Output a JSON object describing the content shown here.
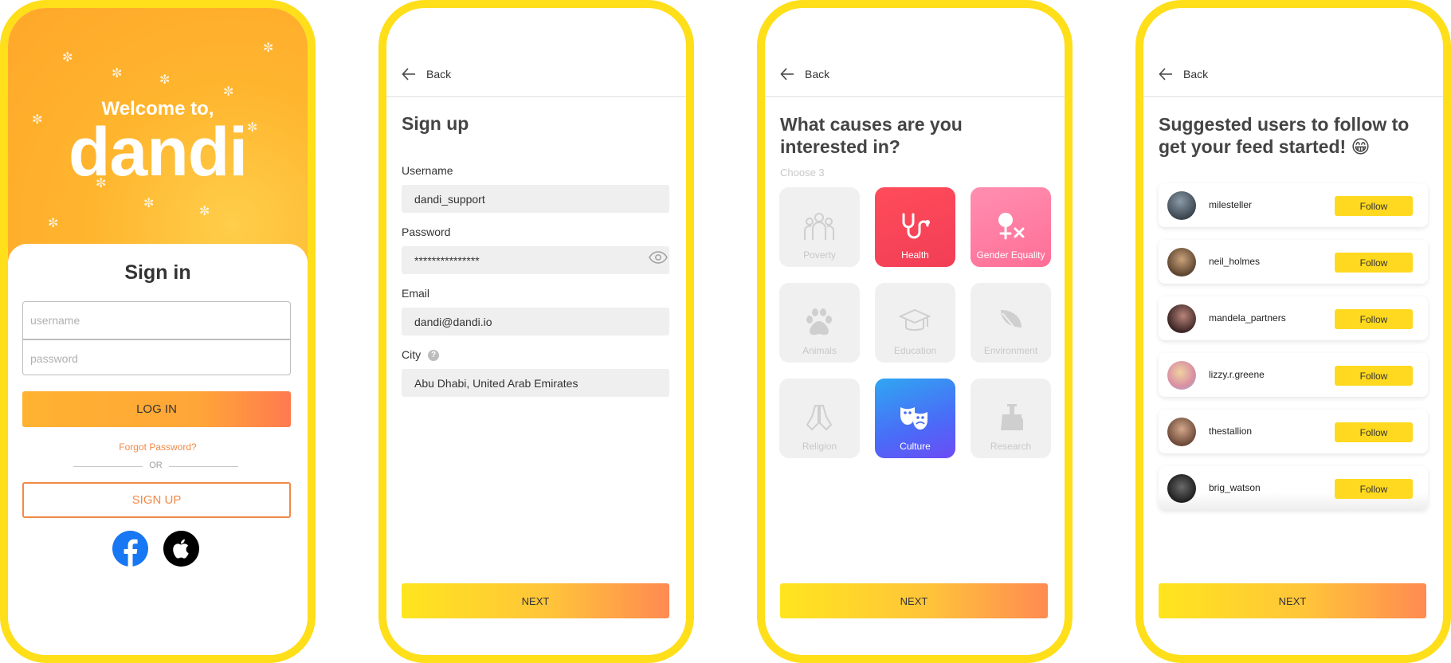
{
  "signin_screen": {
    "welcome": "Welcome to,",
    "logo_text": "dandi",
    "title": "Sign in",
    "username_placeholder": "username",
    "password_placeholder": "password",
    "login_label": "LOG IN",
    "forgot_label": "Forgot Password?",
    "or_label": "OR",
    "signup_label": "SIGN UP",
    "social": [
      {
        "icon": "facebook-icon",
        "color": "#1877F2"
      },
      {
        "icon": "apple-icon",
        "color": "#000000"
      }
    ]
  },
  "signup_screen": {
    "back_label": "Back",
    "title": "Sign up",
    "username_label": "Username",
    "username_value": "dandi_support",
    "password_label": "Password",
    "password_value": "***************",
    "email_label": "Email",
    "email_value": "dandi@dandi.io",
    "city_label": "City",
    "city_help": "?",
    "city_value": "Abu Dhabi, United Arab Emirates",
    "next_label": "NEXT"
  },
  "causes_screen": {
    "back_label": "Back",
    "title": "What causes are you interested in?",
    "subtitle": "Choose 3",
    "causes": [
      {
        "label": "Poverty",
        "icon": "people-group-icon",
        "selected": false
      },
      {
        "label": "Health",
        "icon": "stethoscope-icon",
        "selected": true
      },
      {
        "label": "Gender Equality",
        "icon": "gender-equality-icon",
        "selected": true
      },
      {
        "label": "Animals",
        "icon": "paw-icon",
        "selected": false
      },
      {
        "label": "Education",
        "icon": "graduation-cap-icon",
        "selected": false
      },
      {
        "label": "Environment",
        "icon": "leaf-icon",
        "selected": false
      },
      {
        "label": "Religion",
        "icon": "praying-hands-icon",
        "selected": false
      },
      {
        "label": "Culture",
        "icon": "theater-masks-icon",
        "selected": true
      },
      {
        "label": "Research",
        "icon": "flasks-icon",
        "selected": false
      }
    ],
    "next_label": "NEXT"
  },
  "suggested_screen": {
    "back_label": "Back",
    "title": "Suggested users to follow to get your feed started! 😁",
    "users": [
      {
        "name": "milesteller",
        "follow": "Follow"
      },
      {
        "name": "neil_holmes",
        "follow": "Follow"
      },
      {
        "name": "mandela_partners",
        "follow": "Follow"
      },
      {
        "name": "lizzy.r.greene",
        "follow": "Follow"
      },
      {
        "name": "thestallion",
        "follow": "Follow"
      },
      {
        "name": "brig_watson",
        "follow": "Follow"
      }
    ],
    "next_label": "NEXT"
  },
  "colors": {
    "frame": "#FFDE1A",
    "accent_orange": "#F08A48",
    "follow_yellow": "#FFD91F"
  }
}
